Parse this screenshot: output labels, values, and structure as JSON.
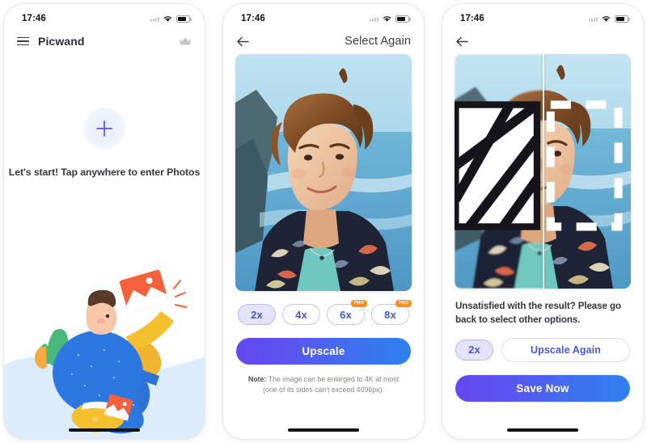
{
  "accent": {
    "gradient_start": "#6348ef",
    "gradient_end": "#2f81f0",
    "pill_blue": "#4a55d6",
    "pro_orange": "#f89021",
    "pill_active_fill": "#e3e4fa"
  },
  "screen1": {
    "status": {
      "time": "17:46",
      "signal_icon": "signal-dots-icon",
      "wifi_icon": "wifi-icon",
      "battery_icon": "battery-icon"
    },
    "nav": {
      "menu_icon": "hamburger-menu-icon",
      "title": "Picwand",
      "premium_icon": "crown-icon"
    },
    "empty_state": {
      "add_icon": "plus-icon",
      "hint": "Let's start! Tap anywhere to enter Photos"
    },
    "illustration_name": "person-with-photos-illustration"
  },
  "screen2": {
    "status": {
      "time": "17:46",
      "signal_icon": "signal-dots-icon",
      "wifi_icon": "wifi-icon",
      "battery_icon": "battery-icon"
    },
    "nav": {
      "back_icon": "back-arrow-icon",
      "action_label": "Select Again"
    },
    "photo_alt": "portrait-of-young-man-at-beach",
    "scale_options": [
      {
        "label": "2x",
        "selected": true,
        "pro": false
      },
      {
        "label": "4x",
        "selected": false,
        "pro": false
      },
      {
        "label": "6x",
        "selected": false,
        "pro": true,
        "pro_label": "PRO"
      },
      {
        "label": "8x",
        "selected": false,
        "pro": true,
        "pro_label": "PRO"
      }
    ],
    "cta_label": "Upscale",
    "note_prefix": "Note:",
    "note_line1": " The image can be enlarged to 4K at most",
    "note_line2": "(one of its sides can't exceed 4096px)."
  },
  "screen3": {
    "status": {
      "time": "17:46",
      "signal_icon": "signal-dots-icon",
      "wifi_icon": "wifi-icon",
      "battery_icon": "battery-icon"
    },
    "nav": {
      "back_icon": "back-arrow-icon"
    },
    "photo_alt": "before-after-comparison-of-upscaled-portrait",
    "compare_icon": "compare-split-icon",
    "message": "Unsatisfied with the result? Please go back to select other options.",
    "scale_chip": {
      "label": "2x",
      "selected": true
    },
    "secondary_label": "Upscale Again",
    "cta_label": "Save Now"
  }
}
